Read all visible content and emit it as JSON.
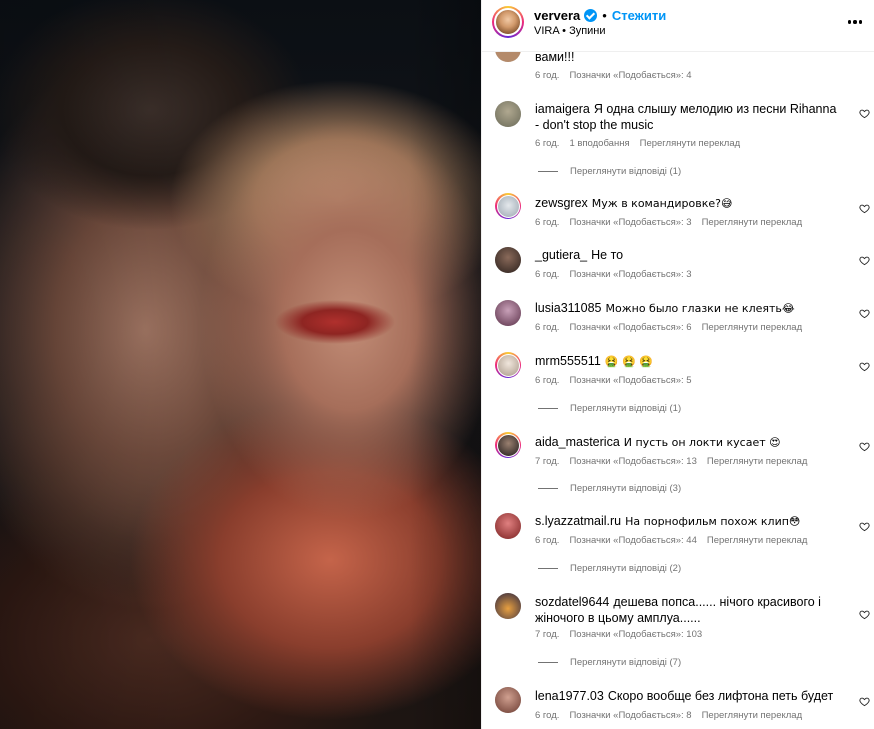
{
  "post": {
    "username": "ververa",
    "follow_label": "Стежити",
    "subtitle_artist": "VIRA",
    "subtitle_track": "Зупини"
  },
  "icons": {
    "verified": "verified-badge-icon",
    "more": "more-horizontal-icon",
    "like": "heart-outline-icon"
  },
  "colors": {
    "accent": "#0095f6",
    "meta_gray": "#737373",
    "divider": "#efefef"
  },
  "comments": [
    {
      "username": "",
      "text": "вами!!!",
      "time": "6 год.",
      "likes": "Позначки «Подобається»: 4",
      "translate": "",
      "replies": "",
      "avatar_color": "#b48a6a"
    },
    {
      "username": "iamaigera",
      "text": "Я одна слышу мелодию из песни Rihanna - don't stop the music",
      "time": "6 год.",
      "likes": "1 вподобання",
      "translate": "Переглянути переклад",
      "replies": "Переглянути відповіді (1)",
      "avatar_color": "#8c8c7c"
    },
    {
      "username": "zewsgrex",
      "text": "Муж в командировке?😅",
      "time": "6 год.",
      "likes": "Позначки «Подобається»: 3",
      "translate": "Переглянути переклад",
      "replies": "",
      "avatar_color": "#b8c2cc"
    },
    {
      "username": "_gutiera_",
      "text": "Не то",
      "time": "6 год.",
      "likes": "Позначки «Подобається»: 3",
      "translate": "",
      "replies": "",
      "avatar_color": "#4a3a32"
    },
    {
      "username": "lusia311085",
      "text": "Можно было глазки не клеять😂",
      "time": "6 год.",
      "likes": "Позначки «Подобається»: 6",
      "translate": "Переглянути переклад",
      "replies": "",
      "avatar_color": "#8a5a78"
    },
    {
      "username": "mrm555511",
      "text": "🤮 🤮 🤮",
      "time": "6 год.",
      "likes": "Позначки «Подобається»: 5",
      "translate": "",
      "replies": "Переглянути відповіді (1)",
      "avatar_color": "#c9b8a8"
    },
    {
      "username": "aida_masterica",
      "text": "И пусть он локти кусает 😍",
      "time": "7 год.",
      "likes": "Позначки «Подобається»: 13",
      "translate": "Переглянути переклад",
      "replies": "Переглянути відповіді (3)",
      "avatar_color": "#3a3232"
    },
    {
      "username": "s.lyazzatmail.ru",
      "text": "На порнофильм похож клип😳",
      "time": "6 год.",
      "likes": "Позначки «Подобається»: 44",
      "translate": "Переглянути переклад",
      "replies": "Переглянути відповіді (2)",
      "avatar_color": "#b84040"
    },
    {
      "username": "sozdatel9644",
      "text": "дешева попса...... нічого красивого і жіночого в цьому амплуа......",
      "time": "7 год.",
      "likes": "Позначки «Подобається»: 103",
      "translate": "",
      "replies": "Переглянути відповіді (7)",
      "avatar_color": "#2c2840"
    },
    {
      "username": "lena1977.03",
      "text": "Скоро вообще без лифтона петь будет",
      "time": "6 год.",
      "likes": "Позначки «Подобається»: 8",
      "translate": "Переглянути переклад",
      "replies": "",
      "avatar_color": "#9a7060"
    }
  ]
}
